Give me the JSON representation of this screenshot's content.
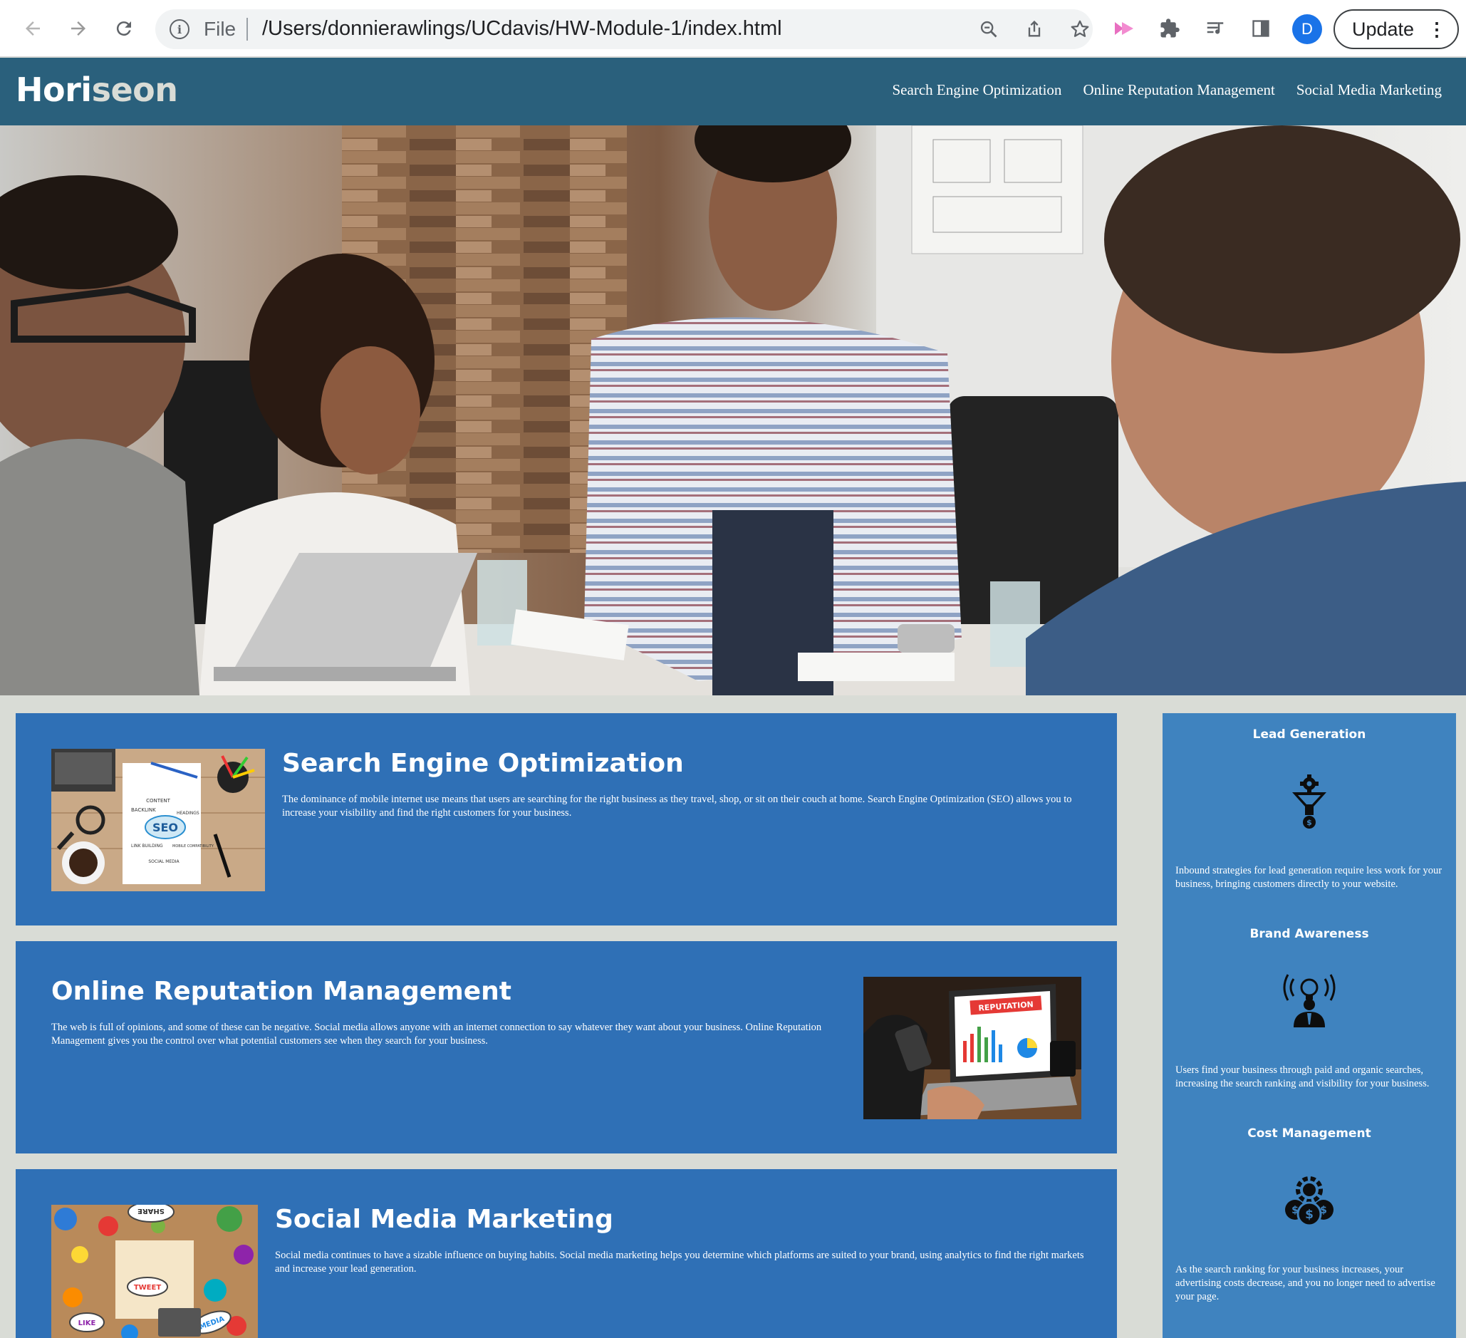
{
  "browser": {
    "scheme_label": "File",
    "url": "/Users/donnierawlings/UCdavis/HW-Module-1/index.html",
    "avatar_letter": "D",
    "update_label": "Update",
    "icons": [
      "back-arrow-icon",
      "forward-arrow-icon",
      "reload-icon",
      "info-icon",
      "zoom-icon",
      "share-icon",
      "bookmark-star-icon",
      "extension-arrow-icon",
      "puzzle-icon",
      "media-queue-icon",
      "side-panel-icon",
      "kebab-menu-icon"
    ]
  },
  "site": {
    "logo_part1": "Hori",
    "logo_part2": "seon",
    "nav": [
      {
        "label": "Search Engine Optimization"
      },
      {
        "label": "Online Reputation Management"
      },
      {
        "label": "Social Media Marketing"
      }
    ],
    "colors": {
      "header": "#2a607c",
      "card": "#2f70b6",
      "sidebar": "#3f83bf",
      "page_bg": "#d9dcd6"
    }
  },
  "cards": [
    {
      "title": "Search Engine Optimization",
      "body": "The dominance of mobile internet use means that users are searching for the right business as they travel, shop, or sit on their couch at home. Search Engine Optimization (SEO) allows you to increase your visibility and find the right customers for your business.",
      "image_words": {
        "main": "SEO",
        "backlink": "BACKLINK",
        "content": "CONTENT",
        "headings": "HEADINGS",
        "link_building": "LINK BUILDING",
        "mobile": "MOBILE COMPATIBILITY",
        "social": "SOCIAL MEDIA"
      }
    },
    {
      "title": "Online Reputation Management",
      "body": "The web is full of opinions, and some of these can be negative. Social media allows anyone with an internet connection to say whatever they want about your business. Online Reputation Management gives you the control over what potential customers see when they search for your business.",
      "image_words": {
        "banner": "REPUTATION"
      }
    },
    {
      "title": "Social Media Marketing",
      "body": "Social media continues to have a sizable influence on buying habits. Social media marketing helps you determine which platforms are suited to your brand, using analytics to find the right markets and increase your lead generation.",
      "image_words": {
        "share": "SHARE",
        "tweet": "TWEET",
        "like": "LIKE",
        "media": "MEDIA"
      }
    }
  ],
  "benefits": [
    {
      "title": "Lead Generation",
      "icon": "funnel-gear-icon",
      "body": "Inbound strategies for lead generation require less work for your business, bringing customers directly to your website."
    },
    {
      "title": "Brand Awareness",
      "icon": "lightbulb-person-icon",
      "body": "Users find your business through paid and organic searches, increasing the search ranking and visibility for your business."
    },
    {
      "title": "Cost Management",
      "icon": "coins-gear-icon",
      "body": "As the search ranking for your business increases, your advertising costs decrease, and you no longer need to advertise your page."
    }
  ]
}
